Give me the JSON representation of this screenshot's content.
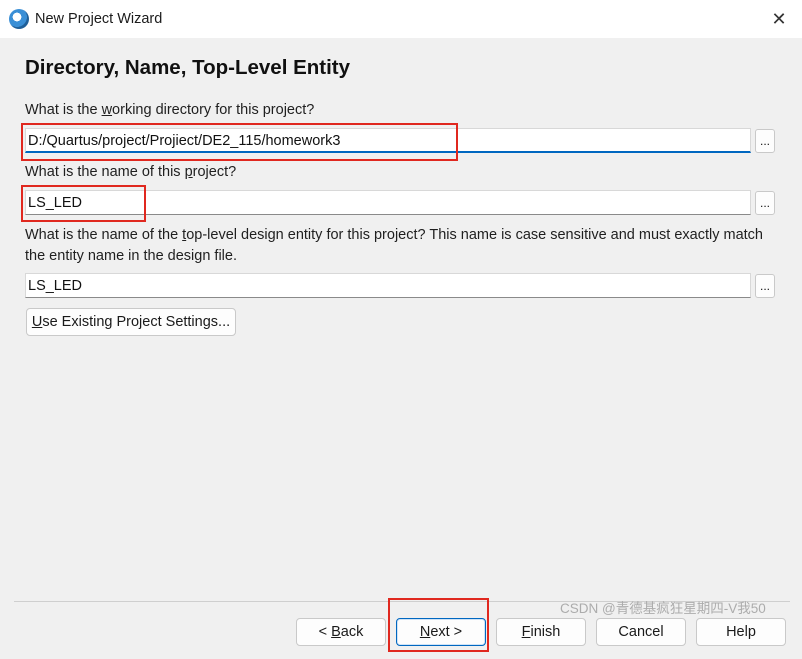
{
  "window": {
    "title": "New Project Wizard",
    "icon": "quartus-app-icon",
    "close_glyph": "✕"
  },
  "page": {
    "heading": "Directory, Name, Top-Level Entity"
  },
  "fields": {
    "directory": {
      "label_pre": "What is the ",
      "label_key": "w",
      "label_post": "orking directory for this project?",
      "value": "D:/Quartus/project/Projiect/DE2_115/homework3"
    },
    "project_name": {
      "label_pre": "What is the name of this ",
      "label_key": "p",
      "label_post": "roject?",
      "value": "LS_LED"
    },
    "top_entity": {
      "label_pre": "What is the name of the ",
      "label_key": "t",
      "label_post": "op-level design entity for this project? This name is case sensitive and must exactly match the entity name in the design file.",
      "value": "LS_LED"
    }
  },
  "browse_label": "...",
  "existing_settings": {
    "key": "U",
    "rest": "se Existing Project Settings..."
  },
  "buttons": {
    "back": {
      "pre": "< ",
      "key": "B",
      "rest": "ack"
    },
    "next": {
      "key": "N",
      "rest": "ext >"
    },
    "finish": {
      "key": "F",
      "rest": "inish"
    },
    "cancel": {
      "label": "Cancel"
    },
    "help": {
      "label": "Help"
    }
  },
  "watermark": "CSDN @青德基疯狂星期四-V我50"
}
